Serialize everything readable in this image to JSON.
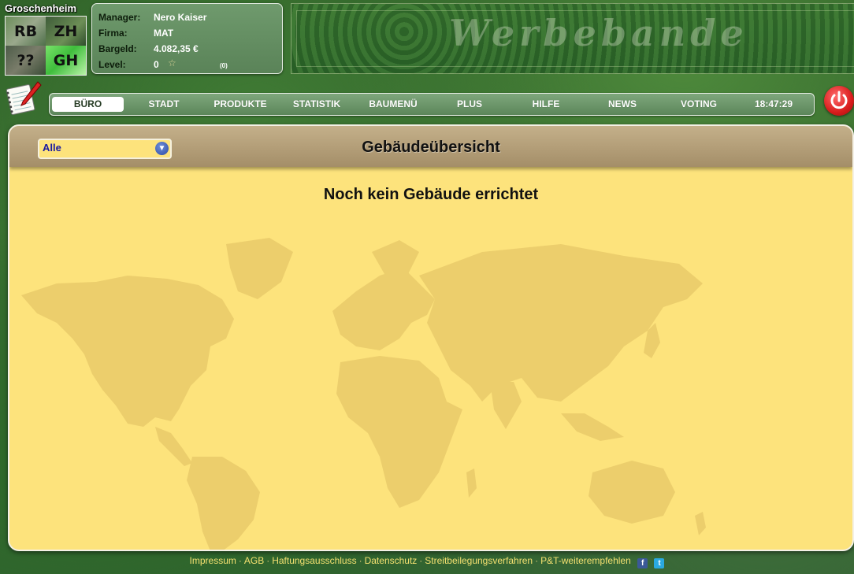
{
  "city": {
    "name": "Groschenheim",
    "tiles": [
      "RB",
      "ZH",
      "??",
      "GH"
    ]
  },
  "manager": {
    "rows": [
      {
        "label": "Manager:",
        "value": "Nero Kaiser"
      },
      {
        "label": "Firma:",
        "value": "MAT"
      },
      {
        "label": "Bargeld:",
        "value": "4.082,35 €"
      },
      {
        "label": "Level:",
        "value": "0"
      }
    ],
    "level_count": "(0)"
  },
  "banner": {
    "text": "Werbebande"
  },
  "nav": {
    "items": [
      "BÜRO",
      "STADT",
      "PRODUKTE",
      "STATISTIK",
      "BAUMENÜ",
      "PLUS",
      "HILFE",
      "NEWS",
      "VOTING"
    ],
    "active": "BÜRO",
    "clock": "18:47:29"
  },
  "panel": {
    "title": "Gebäudeübersicht",
    "filter_value": "Alle",
    "empty_message": "Noch kein Gebäude errichtet"
  },
  "footer": {
    "links": [
      "Impressum",
      "AGB",
      "Haftungsausschluss",
      "Datenschutz",
      "Streitbeilegungsverfahren",
      "P&T-weiterempfehlen"
    ],
    "separator": "·"
  },
  "colors": {
    "panel_bg": "#fde37c",
    "nav_bg": "#6f9a6d",
    "power": "#e02020"
  }
}
